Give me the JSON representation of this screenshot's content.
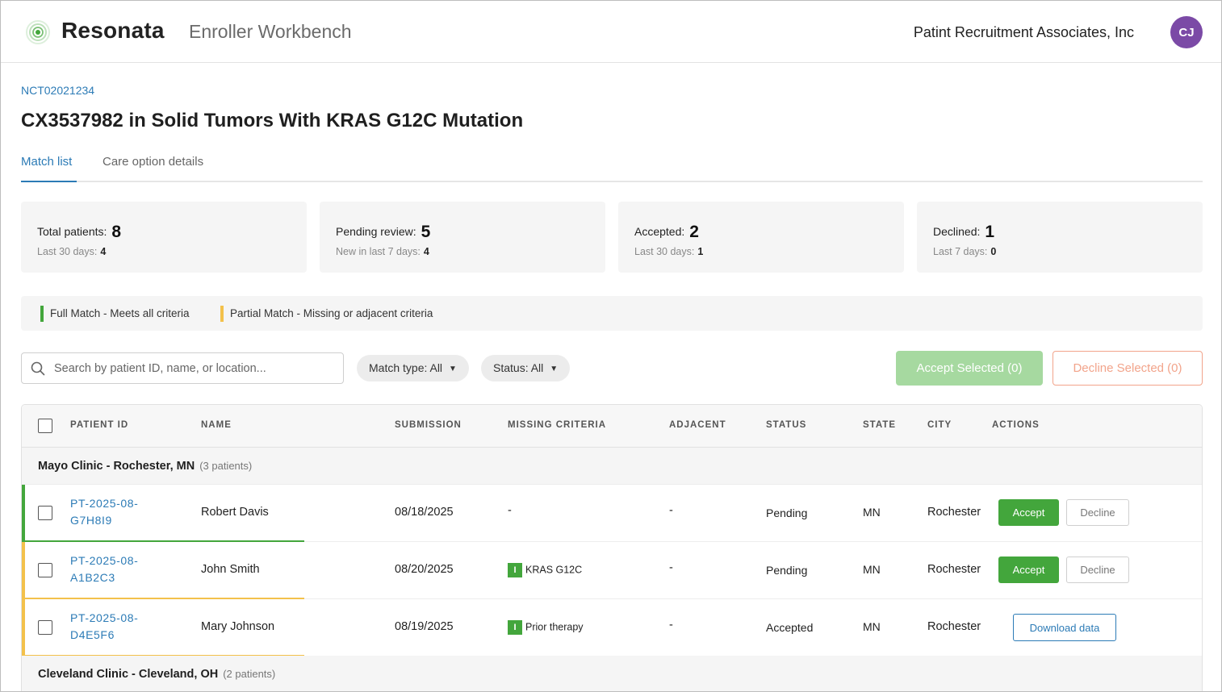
{
  "header": {
    "brand": "Resonata",
    "product": "Enroller Workbench",
    "organization": "Patint Recruitment Associates, Inc",
    "avatar_initials": "CJ",
    "accent_color": "#43a63c",
    "avatar_color": "#7b4aa6"
  },
  "trial": {
    "id": "NCT02021234",
    "title": "CX3537982 in Solid Tumors With KRAS G12C Mutation"
  },
  "tabs": [
    {
      "label": "Match list",
      "active": true
    },
    {
      "label": "Care option details",
      "active": false
    }
  ],
  "stats": [
    {
      "label": "Total patients:",
      "value": "8",
      "sub_label": "Last 30 days:",
      "sub_value": "4"
    },
    {
      "label": "Pending review:",
      "value": "5",
      "sub_label": "New in last 7 days:",
      "sub_value": "4"
    },
    {
      "label": "Accepted:",
      "value": "2",
      "sub_label": "Last 30 days:",
      "sub_value": "1"
    },
    {
      "label": "Declined:",
      "value": "1",
      "sub_label": "Last 7 days:",
      "sub_value": "0"
    }
  ],
  "legend": {
    "full": {
      "label": "Full Match - Meets all criteria",
      "color": "#43a63c"
    },
    "partial": {
      "label": "Partial Match - Missing or adjacent criteria",
      "color": "#f3c14b"
    }
  },
  "toolbar": {
    "search_placeholder": "Search by patient ID, name, or location...",
    "match_type_filter": "Match type: All",
    "status_filter": "Status: All",
    "accept_selected": "Accept Selected (0)",
    "decline_selected": "Decline Selected (0)"
  },
  "table": {
    "columns": [
      "PATIENT ID",
      "NAME",
      "SUBMISSION",
      "MISSING CRITERIA",
      "ADJACENT",
      "STATUS",
      "STATE",
      "CITY",
      "ACTIONS"
    ],
    "groups": [
      {
        "name": "Mayo Clinic - Rochester, MN",
        "count": "(3 patients)",
        "rows": [
          {
            "id_line1": "PT-2025-08-",
            "id_line2": "G7H8I9",
            "name": "Robert Davis",
            "submission": "08/18/2025",
            "missing": "-",
            "adjacent": "-",
            "status": "Pending",
            "state": "MN",
            "city": "Rochester",
            "accept": "Accept",
            "decline": "Decline"
          },
          {
            "id_line1": "PT-2025-08-",
            "id_line2": "A1B2C3",
            "name": "John Smith",
            "submission": "08/20/2025",
            "missing_icon": "I",
            "missing": "KRAS G12C",
            "adjacent": "-",
            "status": "Pending",
            "state": "MN",
            "city": "Rochester",
            "accept": "Accept",
            "decline": "Decline"
          },
          {
            "id_line1": "PT-2025-08-",
            "id_line2": "D4E5F6",
            "name": "Mary Johnson",
            "submission": "08/19/2025",
            "missing_icon": "I",
            "missing": "Prior therapy",
            "adjacent": "-",
            "status": "Accepted",
            "state": "MN",
            "city": "Rochester",
            "download": "Download data"
          }
        ]
      },
      {
        "name": "Cleveland Clinic - Cleveland, OH",
        "count": "(2 patients)"
      }
    ]
  }
}
